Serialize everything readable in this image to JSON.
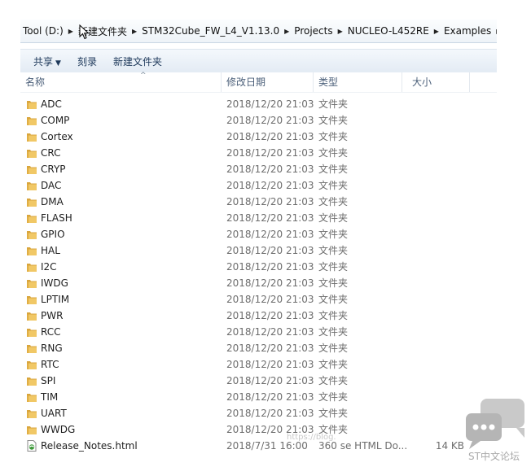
{
  "breadcrumb": [
    {
      "label": "Tool (D:)"
    },
    {
      "label": "新建文件夹"
    },
    {
      "label": "STM32Cube_FW_L4_V1.13.0"
    },
    {
      "label": "Projects"
    },
    {
      "label": "NUCLEO-L452RE"
    },
    {
      "label": "Examples"
    }
  ],
  "toolbar": {
    "share_label": "共享",
    "burn_label": "刻录",
    "new_folder_label": "新建文件夹"
  },
  "columns": {
    "name": "名称",
    "date": "修改日期",
    "type": "类型",
    "size": "大小"
  },
  "files": [
    {
      "name": "ADC",
      "date": "2018/12/20 21:03",
      "type": "文件夹",
      "size": "",
      "icon": "folder-icon"
    },
    {
      "name": "COMP",
      "date": "2018/12/20 21:03",
      "type": "文件夹",
      "size": "",
      "icon": "folder-icon"
    },
    {
      "name": "Cortex",
      "date": "2018/12/20 21:03",
      "type": "文件夹",
      "size": "",
      "icon": "folder-icon"
    },
    {
      "name": "CRC",
      "date": "2018/12/20 21:03",
      "type": "文件夹",
      "size": "",
      "icon": "folder-icon"
    },
    {
      "name": "CRYP",
      "date": "2018/12/20 21:03",
      "type": "文件夹",
      "size": "",
      "icon": "folder-icon"
    },
    {
      "name": "DAC",
      "date": "2018/12/20 21:03",
      "type": "文件夹",
      "size": "",
      "icon": "folder-icon"
    },
    {
      "name": "DMA",
      "date": "2018/12/20 21:03",
      "type": "文件夹",
      "size": "",
      "icon": "folder-icon"
    },
    {
      "name": "FLASH",
      "date": "2018/12/20 21:03",
      "type": "文件夹",
      "size": "",
      "icon": "folder-icon"
    },
    {
      "name": "GPIO",
      "date": "2018/12/20 21:03",
      "type": "文件夹",
      "size": "",
      "icon": "folder-icon"
    },
    {
      "name": "HAL",
      "date": "2018/12/20 21:03",
      "type": "文件夹",
      "size": "",
      "icon": "folder-icon"
    },
    {
      "name": "I2C",
      "date": "2018/12/20 21:03",
      "type": "文件夹",
      "size": "",
      "icon": "folder-icon"
    },
    {
      "name": "IWDG",
      "date": "2018/12/20 21:03",
      "type": "文件夹",
      "size": "",
      "icon": "folder-icon"
    },
    {
      "name": "LPTIM",
      "date": "2018/12/20 21:03",
      "type": "文件夹",
      "size": "",
      "icon": "folder-icon"
    },
    {
      "name": "PWR",
      "date": "2018/12/20 21:03",
      "type": "文件夹",
      "size": "",
      "icon": "folder-icon"
    },
    {
      "name": "RCC",
      "date": "2018/12/20 21:03",
      "type": "文件夹",
      "size": "",
      "icon": "folder-icon"
    },
    {
      "name": "RNG",
      "date": "2018/12/20 21:03",
      "type": "文件夹",
      "size": "",
      "icon": "folder-icon"
    },
    {
      "name": "RTC",
      "date": "2018/12/20 21:03",
      "type": "文件夹",
      "size": "",
      "icon": "folder-icon"
    },
    {
      "name": "SPI",
      "date": "2018/12/20 21:03",
      "type": "文件夹",
      "size": "",
      "icon": "folder-icon"
    },
    {
      "name": "TIM",
      "date": "2018/12/20 21:03",
      "type": "文件夹",
      "size": "",
      "icon": "folder-icon"
    },
    {
      "name": "UART",
      "date": "2018/12/20 21:03",
      "type": "文件夹",
      "size": "",
      "icon": "folder-icon"
    },
    {
      "name": "WWDG",
      "date": "2018/12/20 21:03",
      "type": "文件夹",
      "size": "",
      "icon": "folder-icon"
    },
    {
      "name": "Release_Notes.html",
      "date": "2018/7/31 16:00",
      "type": "360 se HTML Do...",
      "size": "14 KB",
      "icon": "html-file-icon"
    }
  ],
  "watermark": "https://blog.",
  "logo_text": "ST中文论坛",
  "colors": {
    "folder": "#e8b64c",
    "toolbar_text": "#1e395b",
    "logo": "#bcbcbc"
  }
}
